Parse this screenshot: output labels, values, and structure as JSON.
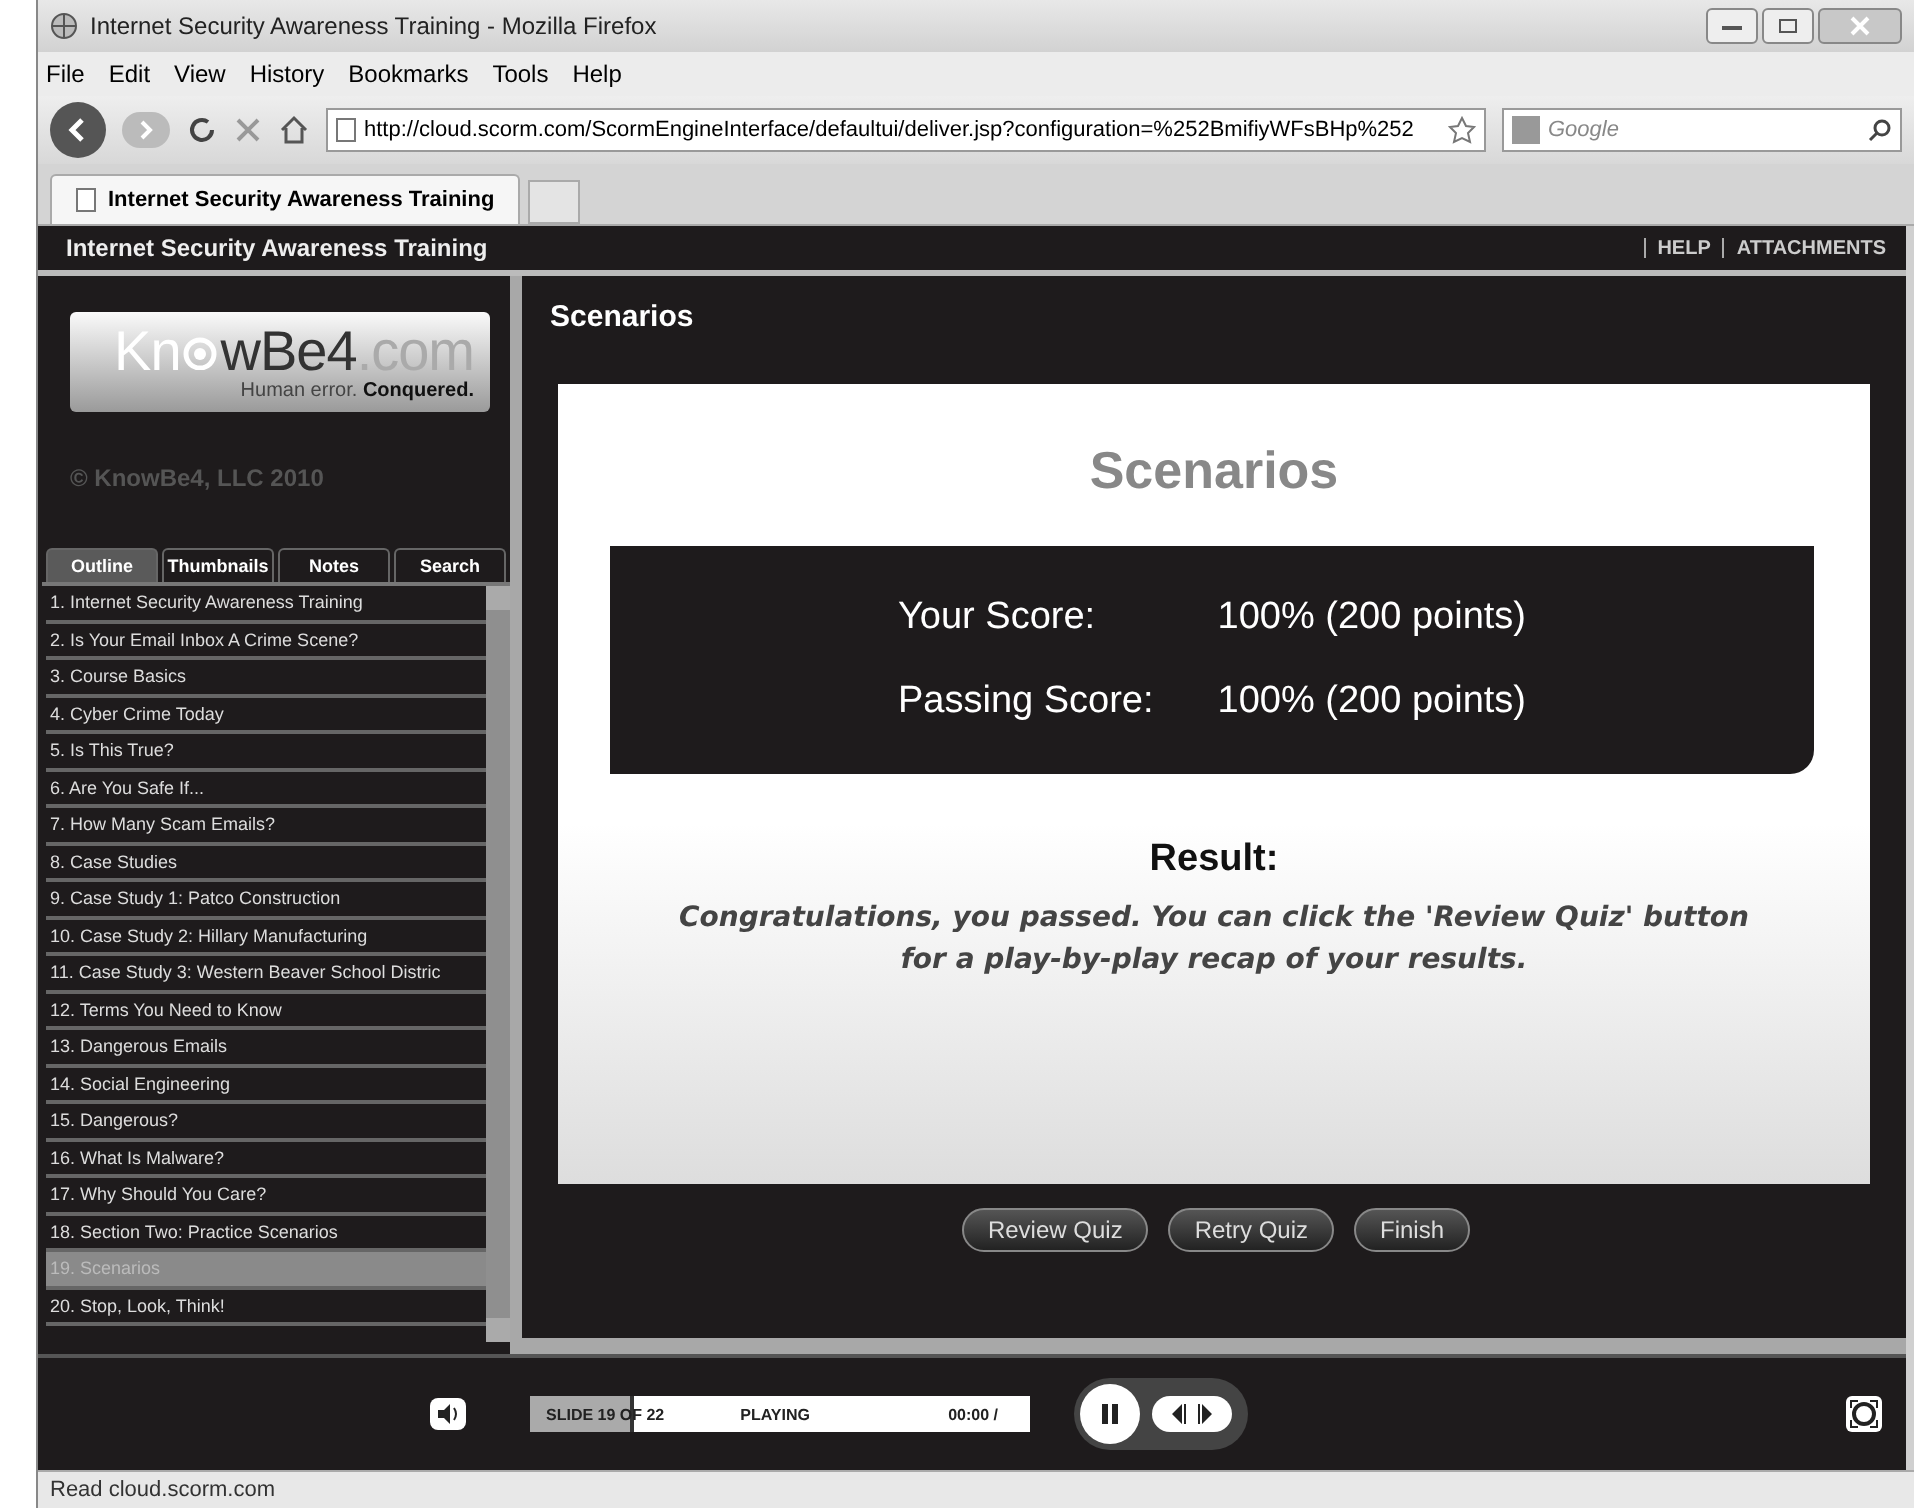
{
  "window": {
    "title": "Internet Security Awareness Training - Mozilla Firefox"
  },
  "menu": [
    "File",
    "Edit",
    "View",
    "History",
    "Bookmarks",
    "Tools",
    "Help"
  ],
  "address_bar": {
    "value": "http://cloud.scorm.com/ScormEngineInterface/defaultui/deliver.jsp?configuration=%252BmifiyWFsBHp%252"
  },
  "search": {
    "placeholder": "Google"
  },
  "tabs": [
    {
      "label": "Internet Security Awareness Training",
      "selected": true
    }
  ],
  "player": {
    "title": "Internet Security Awareness Training",
    "links": [
      "HELP",
      "ATTACHMENTS"
    ],
    "logo": {
      "brand_a": "Kn",
      "brand_b": "wBe4",
      "brand_c": ".com",
      "tagline_a": "Human error. ",
      "tagline_b": "Conquered."
    },
    "copyright": "© KnowBe4, LLC 2010",
    "panel_tabs": [
      {
        "label": "Outline",
        "selected": true
      },
      {
        "label": "Thumbnails",
        "selected": false
      },
      {
        "label": "Notes",
        "selected": false
      },
      {
        "label": "Search",
        "selected": false
      }
    ],
    "outline": [
      {
        "label": "1. Internet Security Awareness Training",
        "selected": false
      },
      {
        "label": "2. Is Your Email Inbox A Crime Scene?",
        "selected": false
      },
      {
        "label": "3. Course Basics",
        "selected": false
      },
      {
        "label": "4. Cyber Crime Today",
        "selected": false
      },
      {
        "label": "5. Is This True?",
        "selected": false
      },
      {
        "label": "6. Are You Safe If...",
        "selected": false
      },
      {
        "label": "7. How Many Scam Emails?",
        "selected": false
      },
      {
        "label": "8. Case Studies",
        "selected": false
      },
      {
        "label": "9. Case Study 1: Patco Construction",
        "selected": false
      },
      {
        "label": "10. Case Study 2: Hillary Manufacturing",
        "selected": false
      },
      {
        "label": "11. Case Study 3: Western Beaver School Distric",
        "selected": false
      },
      {
        "label": "12. Terms You Need to Know",
        "selected": false
      },
      {
        "label": "13. Dangerous Emails",
        "selected": false
      },
      {
        "label": "14. Social Engineering",
        "selected": false
      },
      {
        "label": "15. Dangerous?",
        "selected": false
      },
      {
        "label": "16. What Is Malware?",
        "selected": false
      },
      {
        "label": "17. Why Should You Care?",
        "selected": false
      },
      {
        "label": "18. Section Two: Practice Scenarios",
        "selected": false
      },
      {
        "label": "19. Scenarios",
        "selected": true
      },
      {
        "label": "20. Stop, Look, Think!",
        "selected": false
      }
    ],
    "slide_title": "Scenarios",
    "slide": {
      "heading": "Scenarios",
      "scores": [
        {
          "label": "Your Score:",
          "value": "100% (200 points)"
        },
        {
          "label": "Passing Score:",
          "value": "100% (200 points)"
        }
      ],
      "result_label": "Result:",
      "result_text": "Congratulations, you passed. You can click the 'Review Quiz' button for a play-by-play recap of your results."
    },
    "buttons": [
      "Review Quiz",
      "Retry Quiz",
      "Finish"
    ],
    "progress": {
      "slide": "SLIDE 19 OF 22",
      "status": "PLAYING",
      "time": "00:00 /",
      "level": 0.2
    }
  },
  "status_bar": "Read cloud.scorm.com"
}
